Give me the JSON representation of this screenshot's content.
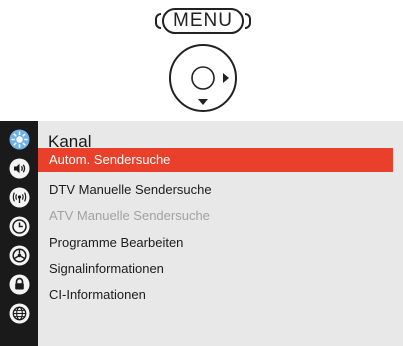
{
  "remote": {
    "menu_key_label": "MENU",
    "dpad_icon": "dpad-right-down-icon"
  },
  "menu": {
    "title": "Kanal",
    "accent_color": "#e8402a",
    "sidebar": [
      {
        "name": "picture-icon",
        "selected": true
      },
      {
        "name": "sound-icon"
      },
      {
        "name": "channel-signal-icon"
      },
      {
        "name": "time-icon"
      },
      {
        "name": "settings-icon"
      },
      {
        "name": "lock-icon"
      },
      {
        "name": "network-icon"
      }
    ],
    "items": [
      {
        "label": "Autom. Sendersuche",
        "state": "selected"
      },
      {
        "label": "DTV Manuelle Sendersuche",
        "state": "normal"
      },
      {
        "label": "ATV Manuelle Sendersuche",
        "state": "disabled"
      },
      {
        "label": "Programme Bearbeiten",
        "state": "normal"
      },
      {
        "label": "Signalinformationen",
        "state": "normal"
      },
      {
        "label": "CI-Informationen",
        "state": "normal"
      }
    ]
  }
}
